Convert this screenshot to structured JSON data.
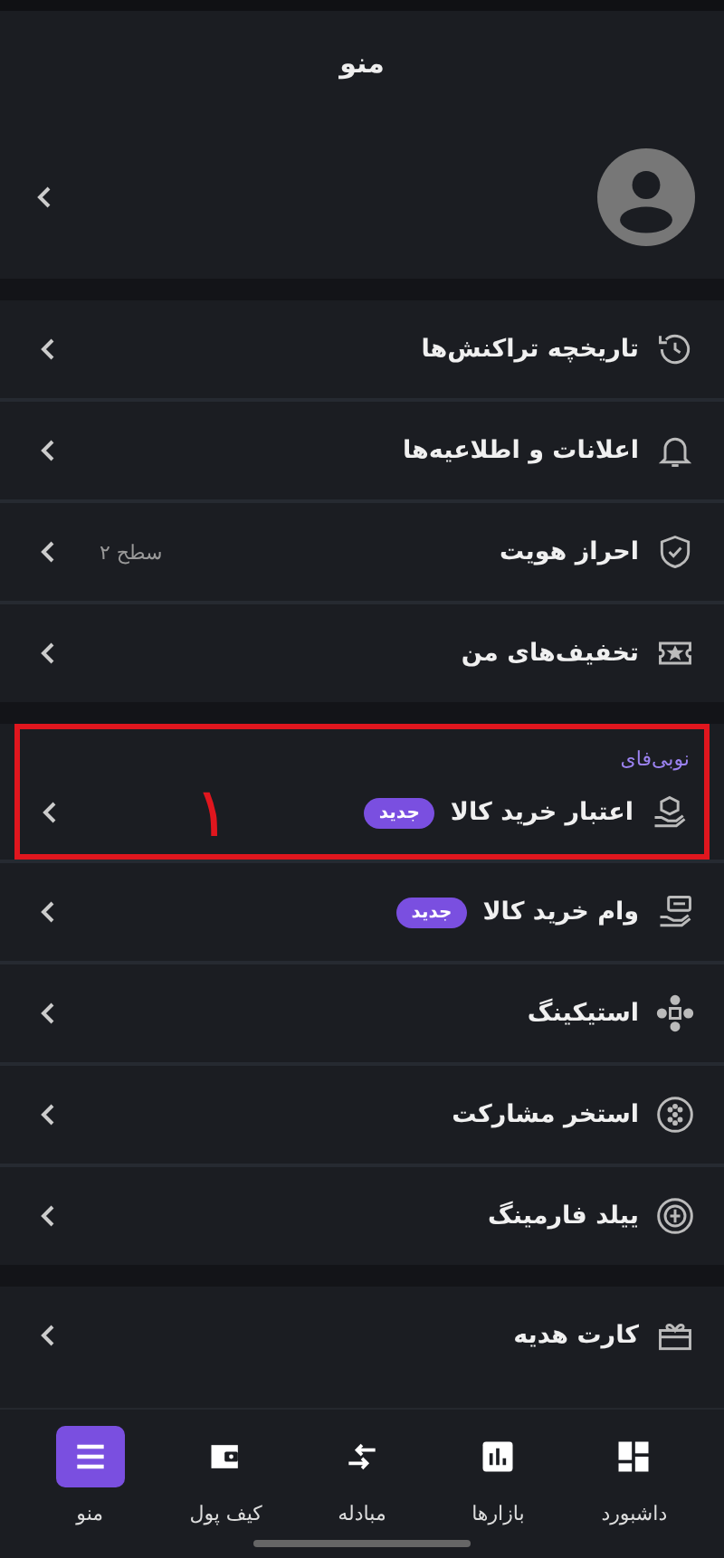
{
  "header": {
    "title": "منو"
  },
  "sections": [
    {
      "items": [
        {
          "label": "تاریخچه تراکنش‌ها"
        },
        {
          "label": "اعلانات و اطلاعیه‌ها"
        },
        {
          "label": "احراز هویت",
          "value": "سطح ۲"
        },
        {
          "label": "تخفیف‌های من"
        }
      ]
    },
    {
      "items": [
        {
          "label": "اعتبار خرید کالا",
          "badge": "جدید",
          "group_title": "نوبی‌فای",
          "annotation": "١"
        },
        {
          "label": "وام خرید کالا",
          "badge": "جدید"
        },
        {
          "label": "استیکینگ"
        },
        {
          "label": "استخر مشارکت"
        },
        {
          "label": "ییلد فارمینگ"
        }
      ]
    },
    {
      "items": [
        {
          "label": "کارت هدیه"
        }
      ]
    }
  ],
  "nav": [
    {
      "label": "داشبورد",
      "selected": false
    },
    {
      "label": "بازارها",
      "selected": false
    },
    {
      "label": "مبادله",
      "selected": false
    },
    {
      "label": "کیف پول",
      "selected": false
    },
    {
      "label": "منو",
      "selected": true
    }
  ]
}
